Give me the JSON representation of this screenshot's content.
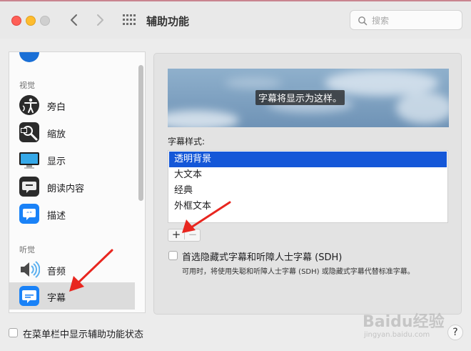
{
  "window": {
    "title": "辅助功能"
  },
  "search": {
    "placeholder": "搜索"
  },
  "sidebar": {
    "sections": [
      {
        "label": "视觉"
      },
      {
        "label": "听觉"
      }
    ],
    "items": [
      {
        "label": "旁白",
        "icon": "voiceover-icon"
      },
      {
        "label": "缩放",
        "icon": "zoom-icon"
      },
      {
        "label": "显示",
        "icon": "display-icon"
      },
      {
        "label": "朗读内容",
        "icon": "spoken-content-icon"
      },
      {
        "label": "描述",
        "icon": "descriptions-icon"
      },
      {
        "label": "音频",
        "icon": "audio-icon"
      },
      {
        "label": "字幕",
        "icon": "captions-icon",
        "selected": true
      }
    ]
  },
  "panel": {
    "preview_caption": "字幕将显示为这样。",
    "style_label": "字幕样式:",
    "styles": [
      {
        "label": "透明背景",
        "selected": true
      },
      {
        "label": "大文本"
      },
      {
        "label": "经典"
      },
      {
        "label": "外框文本"
      }
    ],
    "add_label": "+",
    "remove_label": "−",
    "sdh_label": "首选隐藏式字幕和听障人士字幕 (SDH)",
    "sdh_checked": false,
    "sdh_description": "可用时，将使用失聪和听障人士字幕 (SDH) 或隐藏式字幕代替标准字幕。"
  },
  "footer": {
    "menu_status_label": "在菜单栏中显示辅助功能状态",
    "menu_status_checked": false,
    "help_label": "?"
  },
  "watermark": {
    "logo": "Baidu经验",
    "url": "jingyan.baidu.com"
  },
  "colors": {
    "accent": "#1457d8",
    "sidebar_selected": "#dcdcdc",
    "arrow": "#e8261f"
  }
}
